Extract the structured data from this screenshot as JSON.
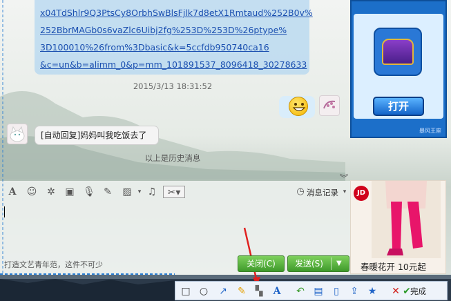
{
  "chat": {
    "link_lines": [
      "x04TdShlr9Q3PtsCy8OrbhSwBlsFjlk7d8etX1Rmtaud%252B0v%",
      "252BbrMAGb0s6vaZlc6Uibj2fg%253D%253D%26ptype%",
      "3D100010%26from%3Dbasic&k=5ccfdb950740ca16",
      "&c=un&b=alimm_0&p=mm_101891537_8096418_30278633"
    ],
    "timestamp": "2015/3/13 18:31:52",
    "auto_reply": "[自动回复]妈妈叫我吃饭去了",
    "history_note": "以上是历史消息",
    "message_record": "消息记录",
    "signature": "打造文艺青年范，这件不可少"
  },
  "buttons": {
    "close": "关闭(C)",
    "send": "发送(S)"
  },
  "game_ad": {
    "open": "打开",
    "footer": "暴风王座"
  },
  "jd_ad": {
    "logo": "JD",
    "text": "春暖花开 10元起"
  },
  "snip_toolbar": {
    "done": "完成"
  }
}
